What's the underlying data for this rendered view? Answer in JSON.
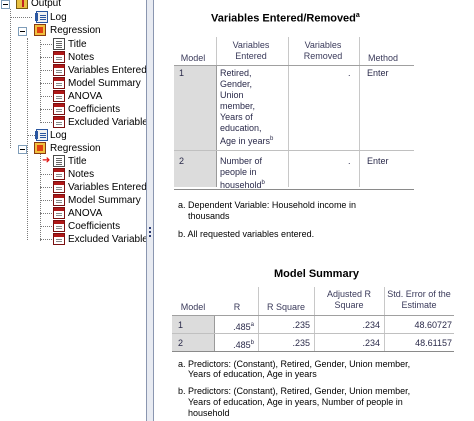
{
  "outline": {
    "root": "Output",
    "items": [
      {
        "label": "Log",
        "icon": "log-icon"
      },
      {
        "label": "Regression",
        "icon": "regression-icon"
      },
      {
        "label": "Title",
        "icon": "title-doc-icon"
      },
      {
        "label": "Notes",
        "icon": "notes-table-icon"
      },
      {
        "label": "Variables Entered",
        "icon": "table-icon"
      },
      {
        "label": "Model Summary",
        "icon": "table-icon"
      },
      {
        "label": "ANOVA",
        "icon": "table-icon"
      },
      {
        "label": "Coefficients",
        "icon": "table-icon"
      },
      {
        "label": "Excluded Variable",
        "icon": "table-icon"
      },
      {
        "label": "Log",
        "icon": "log-icon"
      },
      {
        "label": "Regression",
        "icon": "regression-icon"
      },
      {
        "label": "Title",
        "icon": "title-doc-icon"
      },
      {
        "label": "Notes",
        "icon": "notes-table-icon"
      },
      {
        "label": "Variables Entered",
        "icon": "table-icon"
      },
      {
        "label": "Model Summary",
        "icon": "table-icon"
      },
      {
        "label": "ANOVA",
        "icon": "table-icon"
      },
      {
        "label": "Coefficients",
        "icon": "table-icon"
      },
      {
        "label": "Excluded Variable",
        "icon": "table-icon"
      }
    ]
  },
  "var_table": {
    "title": "Variables Entered/Removed",
    "title_sup": "a",
    "headers": {
      "model": "Model",
      "entered": "Variables Entered",
      "removed": "Variables Removed",
      "method": "Method"
    },
    "rows": [
      {
        "model": "1",
        "entered_lines": [
          "Retired,",
          "Gender,",
          "Union",
          "member,",
          "Years of",
          "education,",
          "Age in years"
        ],
        "entered_sup": "b",
        "removed": ".",
        "method": "Enter"
      },
      {
        "model": "2",
        "entered_lines": [
          "Number of",
          "people in",
          "household"
        ],
        "entered_sup": "b",
        "removed": ".",
        "method": "Enter"
      }
    ],
    "footnotes": [
      {
        "line1": "a. Dependent Variable: Household income in",
        "line2": "thousands"
      },
      {
        "line1": "b. All requested variables entered.",
        "line2": ""
      }
    ]
  },
  "model_summary": {
    "title": "Model Summary",
    "headers": {
      "model": "Model",
      "r": "R",
      "r_square": "R Square",
      "adj_r_square": "Adjusted R Square",
      "std_error": "Std. Error of the Estimate"
    },
    "rows": [
      {
        "model": "1",
        "r": ".485",
        "r_sup": "a",
        "r_square": ".235",
        "adj_r_square": ".234",
        "std_error": "48.60727"
      },
      {
        "model": "2",
        "r": ".485",
        "r_sup": "b",
        "r_square": ".235",
        "adj_r_square": ".234",
        "std_error": "48.61157"
      }
    ],
    "footnotes": [
      {
        "lines": [
          "a. Predictors: (Constant), Retired, Gender, Union member,",
          "Years of education, Age in years"
        ]
      },
      {
        "lines": [
          "b. Predictors: (Constant), Retired, Gender, Union member,",
          "Years of education, Age in years, Number of people in",
          "household"
        ]
      }
    ]
  }
}
